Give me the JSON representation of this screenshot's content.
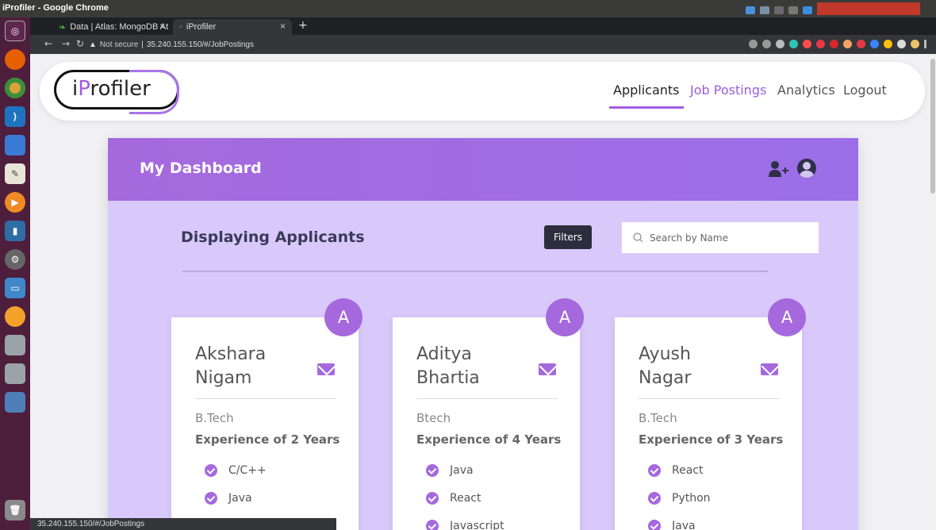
{
  "os": {
    "window_title": "iProfiler - Google Chrome"
  },
  "launcher": {
    "items": [
      "ubuntu-logo-icon",
      "firefox-icon",
      "chrome-icon",
      "vscode-icon",
      "files-icon",
      "text-editor-icon",
      "media-player-icon",
      "chart-app-icon",
      "settings-icon",
      "presentation-icon",
      "web-browser-icon",
      "drive-icon",
      "drive-icon",
      "disk-icon",
      "trash-icon"
    ]
  },
  "browser": {
    "tabs": [
      {
        "label": "Data | Atlas: MongoDB At",
        "close": "×"
      },
      {
        "label": "iProfiler",
        "close": "×"
      }
    ],
    "new_tab": "+",
    "security": "Not secure",
    "url": "35.240.155.150/#/JobPostings",
    "status_url": "35.240.155.150/#/JobPostings"
  },
  "app": {
    "logo_prefix": "i",
    "logo_accent": "P",
    "logo_suffix": "rofiler",
    "nav": {
      "applicants": "Applicants",
      "job_postings": "Job Postings",
      "analytics": "Analytics",
      "logout": "Logout"
    },
    "dashboard": {
      "title": "My Dashboard",
      "section_title": "Displaying Applicants",
      "filters_label": "Filters",
      "search_placeholder": "Search by Name"
    },
    "applicants": [
      {
        "initial": "A",
        "first_name": "Akshara",
        "last_name": "Nigam",
        "degree": "B.Tech",
        "experience": "Experience of 2 Years",
        "skills": [
          "C/C++",
          "Java"
        ]
      },
      {
        "initial": "A",
        "first_name": "Aditya",
        "last_name": "Bhartia",
        "degree": "Btech",
        "experience": "Experience of 4 Years",
        "skills": [
          "Java",
          "React",
          "Javascript"
        ]
      },
      {
        "initial": "A",
        "first_name": "Ayush",
        "last_name": "Nagar",
        "degree": "B.Tech",
        "experience": "Experience of 3 Years",
        "skills": [
          "React",
          "Python",
          "Java"
        ]
      }
    ]
  },
  "colors": {
    "accent": "#a569dd",
    "dash_bg": "#d9c9fb",
    "header_gradient_start": "#a569dd",
    "header_gradient_end": "#9b6ee8"
  }
}
